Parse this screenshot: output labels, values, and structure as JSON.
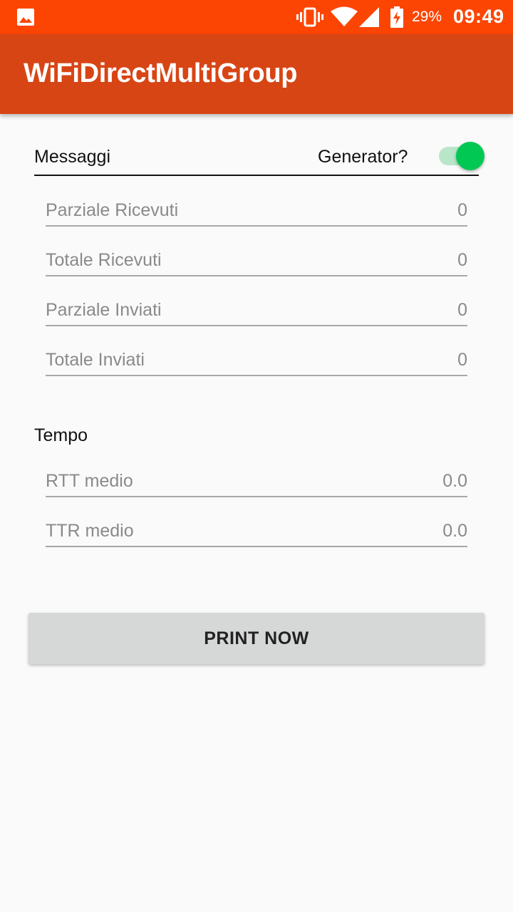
{
  "status_bar": {
    "left_icon": "image-icon",
    "battery_percent": "29%",
    "time": "09:49",
    "icons": [
      "vibrate-icon",
      "wifi-icon",
      "signal-icon",
      "battery-charging-icon"
    ]
  },
  "app_bar": {
    "title": "WiFiDirectMultiGroup"
  },
  "messaggi": {
    "header": "Messaggi",
    "generator_label": "Generator?",
    "generator_on": true,
    "fields": [
      {
        "label": "Parziale Ricevuti",
        "value": "0"
      },
      {
        "label": "Totale Ricevuti",
        "value": "0"
      },
      {
        "label": "Parziale Inviati",
        "value": "0"
      },
      {
        "label": "Totale Inviati",
        "value": "0"
      }
    ]
  },
  "tempo": {
    "header": "Tempo",
    "fields": [
      {
        "label": "RTT medio",
        "value": "0.0"
      },
      {
        "label": "TTR medio",
        "value": "0.0"
      }
    ]
  },
  "actions": {
    "print_label": "PRINT NOW"
  },
  "colors": {
    "status_bar": "#fc4503",
    "app_bar": "#d84515",
    "switch_thumb": "#00c853",
    "switch_track": "#b8e6c9",
    "button": "#d6d7d7"
  }
}
